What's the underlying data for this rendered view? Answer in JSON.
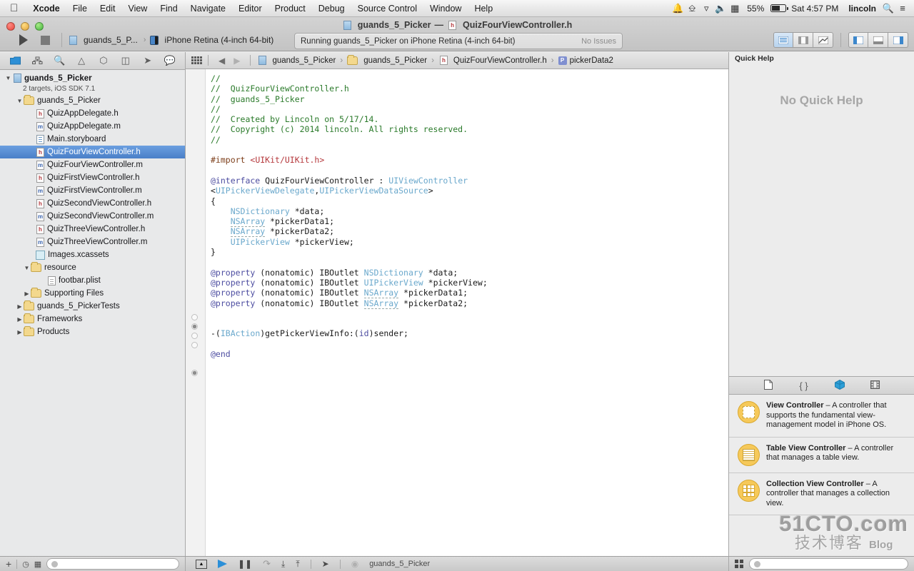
{
  "menubar": {
    "apple_icon": "apple-logo",
    "items": [
      "Xcode",
      "File",
      "Edit",
      "View",
      "Find",
      "Navigate",
      "Editor",
      "Product",
      "Debug",
      "Source Control",
      "Window",
      "Help"
    ],
    "status_icons": [
      "bell-icon",
      "keyboard-icon",
      "wifi-icon",
      "volume-icon",
      "input-source-icon"
    ],
    "battery_percent": "55%",
    "clock": "Sat 4:57 PM",
    "user": "lincoln",
    "spotlight_icon": "search-icon",
    "notification_center_icon": "list-icon"
  },
  "toolbar": {
    "window_title": "guands_5_Picker — QuizFourViewController.h",
    "window_title_project": "guands_5_Picker",
    "window_title_sep": "—",
    "window_title_file": "QuizFourViewController.h",
    "run_label": "run-button",
    "stop_label": "stop-button",
    "scheme_name": "guands_5_P...",
    "destination": "iPhone Retina (4-inch 64-bit)",
    "status_text": "Running guands_5_Picker on iPhone Retina (4-inch 64-bit)",
    "issues_text": "No Issues",
    "editor_buttons": [
      "standard-editor-icon",
      "assistant-editor-icon",
      "version-editor-icon"
    ],
    "view_buttons": [
      "navigator-toggle-icon",
      "debug-area-toggle-icon",
      "utilities-toggle-icon"
    ]
  },
  "navigator": {
    "tabs": [
      "project-navigator-icon",
      "symbol-navigator-icon",
      "search-navigator-icon",
      "issue-navigator-icon",
      "test-navigator-icon",
      "debug-navigator-icon",
      "breakpoint-navigator-icon",
      "report-navigator-icon"
    ],
    "active_tab_index": 0,
    "project": {
      "name": "guands_5_Picker",
      "subtitle": "2 targets, iOS SDK 7.1"
    },
    "items": [
      {
        "label": "guands_5_Picker",
        "icon": "folder-icon",
        "indent": 2,
        "twisty": "down"
      },
      {
        "label": "QuizAppDelegate.h",
        "icon": "header-file-icon",
        "indent": 3,
        "twisty": ""
      },
      {
        "label": "QuizAppDelegate.m",
        "icon": "objc-file-icon",
        "indent": 3,
        "twisty": ""
      },
      {
        "label": "Main.storyboard",
        "icon": "storyboard-icon",
        "indent": 3,
        "twisty": ""
      },
      {
        "label": "QuizFourViewController.h",
        "icon": "header-file-icon",
        "indent": 3,
        "twisty": "",
        "selected": true
      },
      {
        "label": "QuizFourViewController.m",
        "icon": "objc-file-icon",
        "indent": 3,
        "twisty": ""
      },
      {
        "label": "QuizFirstViewController.h",
        "icon": "header-file-icon",
        "indent": 3,
        "twisty": ""
      },
      {
        "label": "QuizFirstViewController.m",
        "icon": "objc-file-icon",
        "indent": 3,
        "twisty": ""
      },
      {
        "label": "QuizSecondViewController.h",
        "icon": "header-file-icon",
        "indent": 3,
        "twisty": ""
      },
      {
        "label": "QuizSecondViewController.m",
        "icon": "objc-file-icon",
        "indent": 3,
        "twisty": ""
      },
      {
        "label": "QuizThreeViewController.h",
        "icon": "header-file-icon",
        "indent": 3,
        "twisty": ""
      },
      {
        "label": "QuizThreeViewController.m",
        "icon": "objc-file-icon",
        "indent": 3,
        "twisty": ""
      },
      {
        "label": "Images.xcassets",
        "icon": "xcassets-icon",
        "indent": 3,
        "twisty": ""
      },
      {
        "label": "resource",
        "icon": "folder-icon",
        "indent": 3,
        "twisty": "down"
      },
      {
        "label": "footbar.plist",
        "icon": "plist-icon",
        "indent": 4,
        "twisty": ""
      },
      {
        "label": "Supporting Files",
        "icon": "folder-icon",
        "indent": 3,
        "twisty": "right"
      },
      {
        "label": "guands_5_PickerTests",
        "icon": "folder-icon",
        "indent": 2,
        "twisty": "right"
      },
      {
        "label": "Frameworks",
        "icon": "folder-icon",
        "indent": 2,
        "twisty": "right"
      },
      {
        "label": "Products",
        "icon": "folder-icon",
        "indent": 2,
        "twisty": "right"
      }
    ]
  },
  "editor": {
    "jumpbar": {
      "related_items_icon": "related-items-icon",
      "back_icon": "back-arrow-icon",
      "forward_icon": "forward-arrow-icon",
      "crumbs": [
        "guands_5_Picker",
        "guands_5_Picker",
        "QuizFourViewController.h",
        "pickerData2"
      ],
      "crumb_icons": [
        "project-icon",
        "folder-icon",
        "header-file-icon",
        "property-icon"
      ],
      "property_badge": "P"
    },
    "filename": "QuizFourViewController.h",
    "code_lines": [
      {
        "t": "comment",
        "text": "//"
      },
      {
        "t": "comment",
        "text": "//  QuizFourViewController.h"
      },
      {
        "t": "comment",
        "text": "//  guands_5_Picker"
      },
      {
        "t": "comment",
        "text": "//"
      },
      {
        "t": "comment",
        "text": "//  Created by Lincoln on 5/17/14."
      },
      {
        "t": "comment",
        "text": "//  Copyright (c) 2014 lincoln. All rights reserved."
      },
      {
        "t": "comment",
        "text": "//"
      },
      {
        "t": "blank",
        "text": ""
      },
      {
        "t": "import",
        "text": "#import <UIKit/UIKit.h>"
      },
      {
        "t": "blank",
        "text": ""
      },
      {
        "t": "code",
        "text": "@interface QuizFourViewController : UIViewController"
      },
      {
        "t": "code",
        "text": "<UIPickerViewDelegate,UIPickerViewDataSource>"
      },
      {
        "t": "code",
        "text": "{"
      },
      {
        "t": "code",
        "text": "    NSDictionary *data;"
      },
      {
        "t": "code",
        "text": "    NSArray *pickerData1;"
      },
      {
        "t": "code",
        "text": "    NSArray *pickerData2;"
      },
      {
        "t": "code",
        "text": "    UIPickerView *pickerView;"
      },
      {
        "t": "code",
        "text": "}"
      },
      {
        "t": "blank",
        "text": ""
      },
      {
        "t": "code",
        "text": "@property (nonatomic) IBOutlet NSDictionary *data;"
      },
      {
        "t": "code",
        "text": "@property (nonatomic) IBOutlet UIPickerView *pickerView;"
      },
      {
        "t": "code",
        "text": "@property (nonatomic) IBOutlet NSArray *pickerData1;"
      },
      {
        "t": "code",
        "text": "@property (nonatomic) IBOutlet NSArray *pickerData2;"
      },
      {
        "t": "blank",
        "text": ""
      },
      {
        "t": "blank",
        "text": ""
      },
      {
        "t": "code",
        "text": "-(IBAction)getPickerViewInfo:(id)sender;"
      },
      {
        "t": "blank",
        "text": ""
      },
      {
        "t": "code",
        "text": "@end"
      }
    ],
    "syntax_colors": {
      "comment": "#2a7a2a",
      "preprocessor": "#7d3f1b",
      "string": "#b5383c",
      "keyword": "#4c4ca0",
      "type": "#6aa8cc",
      "plain": "#1a1a1a"
    }
  },
  "utilities": {
    "quick_help": {
      "title": "Quick Help",
      "empty_message": "No Quick Help"
    },
    "library_tabs": [
      "file-template-library-icon",
      "code-snippet-library-icon",
      "object-library-icon",
      "media-library-icon"
    ],
    "library_active_tab_index": 2,
    "library_items": [
      {
        "icon": "view-controller-icon",
        "title": "View Controller",
        "dash": " – ",
        "desc": "A controller that supports the fundamental view-management model in iPhone OS."
      },
      {
        "icon": "table-view-controller-icon",
        "title": "Table View Controller",
        "dash": " – ",
        "desc": "A controller that manages a table view."
      },
      {
        "icon": "collection-view-controller-icon",
        "title": "Collection View Controller",
        "dash": " – ",
        "desc": "A controller that manages a collection view."
      }
    ],
    "footer": {
      "layout_icon": "grid-layout-icon",
      "search_placeholder": ""
    }
  },
  "bottombar": {
    "add_icon": "plus-icon",
    "filter_icons": [
      "recent-files-icon",
      "source-control-icon"
    ],
    "filter_placeholder": "",
    "debug_buttons": [
      "show-hide-icon",
      "breakpoint-icon",
      "pause-icon",
      "step-over-icon",
      "step-into-icon",
      "step-out-icon"
    ],
    "location_icon": "simulate-location-icon",
    "process_icon": "process-icon",
    "process_name": "guands_5_Picker"
  },
  "watermark": {
    "line1": "51CTO.com",
    "line2": "技术博客",
    "line3": "Blog"
  }
}
